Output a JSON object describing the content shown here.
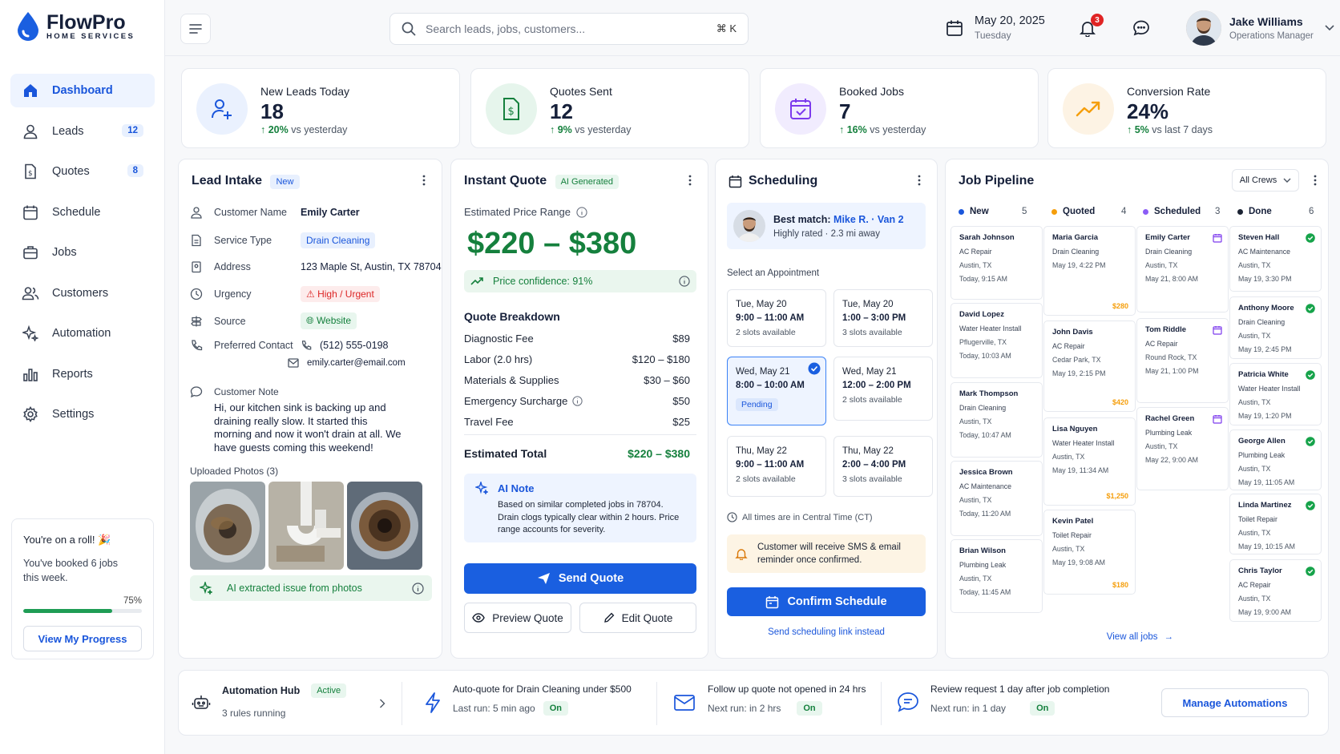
{
  "brand": {
    "name": "FlowPro",
    "sub": "HOME SERVICES"
  },
  "nav": [
    {
      "label": "Dashboard",
      "badge": ""
    },
    {
      "label": "Leads",
      "badge": "12"
    },
    {
      "label": "Quotes",
      "badge": "8"
    },
    {
      "label": "Schedule",
      "badge": ""
    },
    {
      "label": "Jobs",
      "badge": ""
    },
    {
      "label": "Customers",
      "badge": ""
    },
    {
      "label": "Automation",
      "badge": ""
    },
    {
      "label": "Reports",
      "badge": ""
    },
    {
      "label": "Settings",
      "badge": ""
    }
  ],
  "roll": {
    "title": "You're on a roll! 🎉",
    "text": "You've booked 6 jobs this week.",
    "percent": "75%",
    "progress": 0.75,
    "button": "View My Progress"
  },
  "header": {
    "search_placeholder": "Search leads, jobs, customers...",
    "shortcut": "⌘ K",
    "date": "May 20, 2025",
    "weekday": "Tuesday",
    "notifications": "3",
    "user_name": "Jake Williams",
    "user_role": "Operations Manager"
  },
  "stats": [
    {
      "label": "New Leads Today",
      "value": "18",
      "change": "20%",
      "suffix": "vs yesterday"
    },
    {
      "label": "Quotes Sent",
      "value": "12",
      "change": "9%",
      "suffix": "vs yesterday"
    },
    {
      "label": "Booked Jobs",
      "value": "7",
      "change": "16%",
      "suffix": "vs yesterday"
    },
    {
      "label": "Conversion Rate",
      "value": "24%",
      "change": "5%",
      "suffix": "vs last 7 days"
    }
  ],
  "lead": {
    "title": "Lead Intake",
    "badge": "New",
    "fields": {
      "customer_label": "Customer Name",
      "customer": "Emily Carter",
      "service_label": "Service Type",
      "service": "Drain Cleaning",
      "address_label": "Address",
      "address": "123 Maple St, Austin, TX 78704",
      "urgency_label": "Urgency",
      "urgency": "High / Urgent",
      "source_label": "Source",
      "source": "Website",
      "contact_label": "Preferred Contact",
      "phone": "(512) 555-0198",
      "email": "emily.carter@email.com"
    },
    "note_label": "Customer Note",
    "note": "Hi, our kitchen sink is backing up and draining really slow. It started this morning and now it won't drain at all. We have guests coming this weekend!",
    "photos_label": "Uploaded Photos (3)",
    "ai_extract": "AI extracted issue from photos"
  },
  "quote": {
    "title": "Instant Quote",
    "badge": "AI Generated",
    "range_label": "Estimated Price Range",
    "range": "$220 – $380",
    "confidence": "Price confidence: 91%",
    "breakdown_title": "Quote Breakdown",
    "lines": [
      {
        "label": "Diagnostic Fee",
        "value": "$89"
      },
      {
        "label": "Labor (2.0 hrs)",
        "value": "$120 – $180"
      },
      {
        "label": "Materials & Supplies",
        "value": "$30 – $60"
      },
      {
        "label": "Emergency Surcharge",
        "value": "$50"
      },
      {
        "label": "Travel Fee",
        "value": "$25"
      }
    ],
    "total_label": "Estimated Total",
    "total": "$220 – $380",
    "ai_title": "AI Note",
    "ai_text": "Based on similar completed jobs in 78704. Drain clogs typically clear within 2 hours. Price range accounts for severity.",
    "send": "Send Quote",
    "preview": "Preview Quote",
    "edit": "Edit Quote"
  },
  "schedule": {
    "title": "Scheduling",
    "match_prefix": "Best match: ",
    "match_name": "Mike R. · Van 2",
    "match_sub": "Highly rated · 2.3 mi away",
    "select_label": "Select an Appointment",
    "slots": [
      {
        "day": "Tue, May 20",
        "time": "9:00 – 11:00 AM",
        "avail": "2 slots available"
      },
      {
        "day": "Tue, May 20",
        "time": "1:00 – 3:00 PM",
        "avail": "3 slots available"
      },
      {
        "day": "Wed, May 21",
        "time": "8:00 – 10:00 AM",
        "avail": "Pending"
      },
      {
        "day": "Wed, May 21",
        "time": "12:00 – 2:00 PM",
        "avail": "2 slots available"
      },
      {
        "day": "Thu, May 22",
        "time": "9:00 – 11:00 AM",
        "avail": "2 slots available"
      },
      {
        "day": "Thu, May 22",
        "time": "2:00 – 4:00 PM",
        "avail": "3 slots available"
      }
    ],
    "tz": "All times are in Central Time (CT)",
    "reminder": "Customer will receive SMS & email reminder once confirmed.",
    "confirm": "Confirm Schedule",
    "link": "Send scheduling link instead"
  },
  "pipeline": {
    "title": "Job Pipeline",
    "filter": "All Crews",
    "view_all": "View all jobs",
    "columns": [
      {
        "name": "New",
        "count": "5",
        "color": "#1a56db",
        "cards": [
          {
            "name": "Sarah Johnson",
            "type": "AC Repair",
            "loc": "Austin, TX",
            "date": "Today, 9:15 AM"
          },
          {
            "name": "David Lopez",
            "type": "Water Heater Install",
            "loc": "Pflugerville, TX",
            "date": "Today, 10:03 AM"
          },
          {
            "name": "Mark Thompson",
            "type": "Drain Cleaning",
            "loc": "Austin, TX",
            "date": "Today, 10:47 AM"
          },
          {
            "name": "Jessica Brown",
            "type": "AC Maintenance",
            "loc": "Austin, TX",
            "date": "Today, 11:20 AM"
          },
          {
            "name": "Brian Wilson",
            "type": "Plumbing Leak",
            "loc": "Austin, TX",
            "date": "Today, 11:45 AM"
          }
        ]
      },
      {
        "name": "Quoted",
        "count": "4",
        "color": "#f59e0b",
        "cards": [
          {
            "name": "Maria Garcia",
            "type": "Drain Cleaning",
            "loc": "",
            "date": "May 19, 4:22 PM",
            "price": "$280"
          },
          {
            "name": "John Davis",
            "type": "AC Repair",
            "loc": "Cedar Park, TX",
            "date": "May 19, 2:15 PM",
            "price": "$420"
          },
          {
            "name": "Lisa Nguyen",
            "type": "Water Heater Install",
            "loc": "Austin, TX",
            "date": "May 19, 11:34 AM",
            "price": "$1,250"
          },
          {
            "name": "Kevin Patel",
            "type": "Toilet Repair",
            "loc": "Austin, TX",
            "date": "May 19, 9:08 AM",
            "price": "$180"
          }
        ]
      },
      {
        "name": "Scheduled",
        "count": "3",
        "color": "#8b5cf6",
        "cards": [
          {
            "name": "Emily Carter",
            "type": "Drain Cleaning",
            "loc": "Austin, TX",
            "date": "May 21, 8:00 AM"
          },
          {
            "name": "Tom Riddle",
            "type": "AC Repair",
            "loc": "Round Rock, TX",
            "date": "May 21, 1:00 PM"
          },
          {
            "name": "Rachel Green",
            "type": "Plumbing Leak",
            "loc": "Austin, TX",
            "date": "May 22, 9:00 AM"
          }
        ]
      },
      {
        "name": "Done",
        "count": "6",
        "color": "#1b2333",
        "cards": [
          {
            "name": "Steven Hall",
            "type": "AC Maintenance",
            "loc": "Austin, TX",
            "date": "May 19, 3:30 PM"
          },
          {
            "name": "Anthony Moore",
            "type": "Drain Cleaning",
            "loc": "Austin, TX",
            "date": "May 19, 2:45 PM"
          },
          {
            "name": "Patricia White",
            "type": "Water Heater Install",
            "loc": "Austin, TX",
            "date": "May 19, 1:20 PM"
          },
          {
            "name": "George Allen",
            "type": "Plumbing Leak",
            "loc": "Austin, TX",
            "date": "May 19, 11:05 AM"
          },
          {
            "name": "Linda Martinez",
            "type": "Toilet Repair",
            "loc": "Austin, TX",
            "date": "May 19, 10:15 AM"
          },
          {
            "name": "Chris Taylor",
            "type": "AC Repair",
            "loc": "Austin, TX",
            "date": "May 19, 9:00 AM"
          }
        ]
      }
    ]
  },
  "automation": {
    "title": "Automation Hub",
    "badge": "Active",
    "rules": "3 rules running",
    "items": [
      {
        "title": "Auto-quote for Drain Cleaning under $500",
        "sub": "Last run: 5 min ago",
        "state": "On"
      },
      {
        "title": "Follow up quote not opened in 24 hrs",
        "sub": "Next run: in 2 hrs",
        "state": "On"
      },
      {
        "title": "Review request 1 day after job completion",
        "sub": "Next run: in 1 day",
        "state": "On"
      }
    ],
    "manage": "Manage Automations"
  },
  "colors": {
    "primary": "#1a5fe0",
    "success": "#15803d",
    "warning": "#f59e0b",
    "danger": "#dc2626"
  }
}
